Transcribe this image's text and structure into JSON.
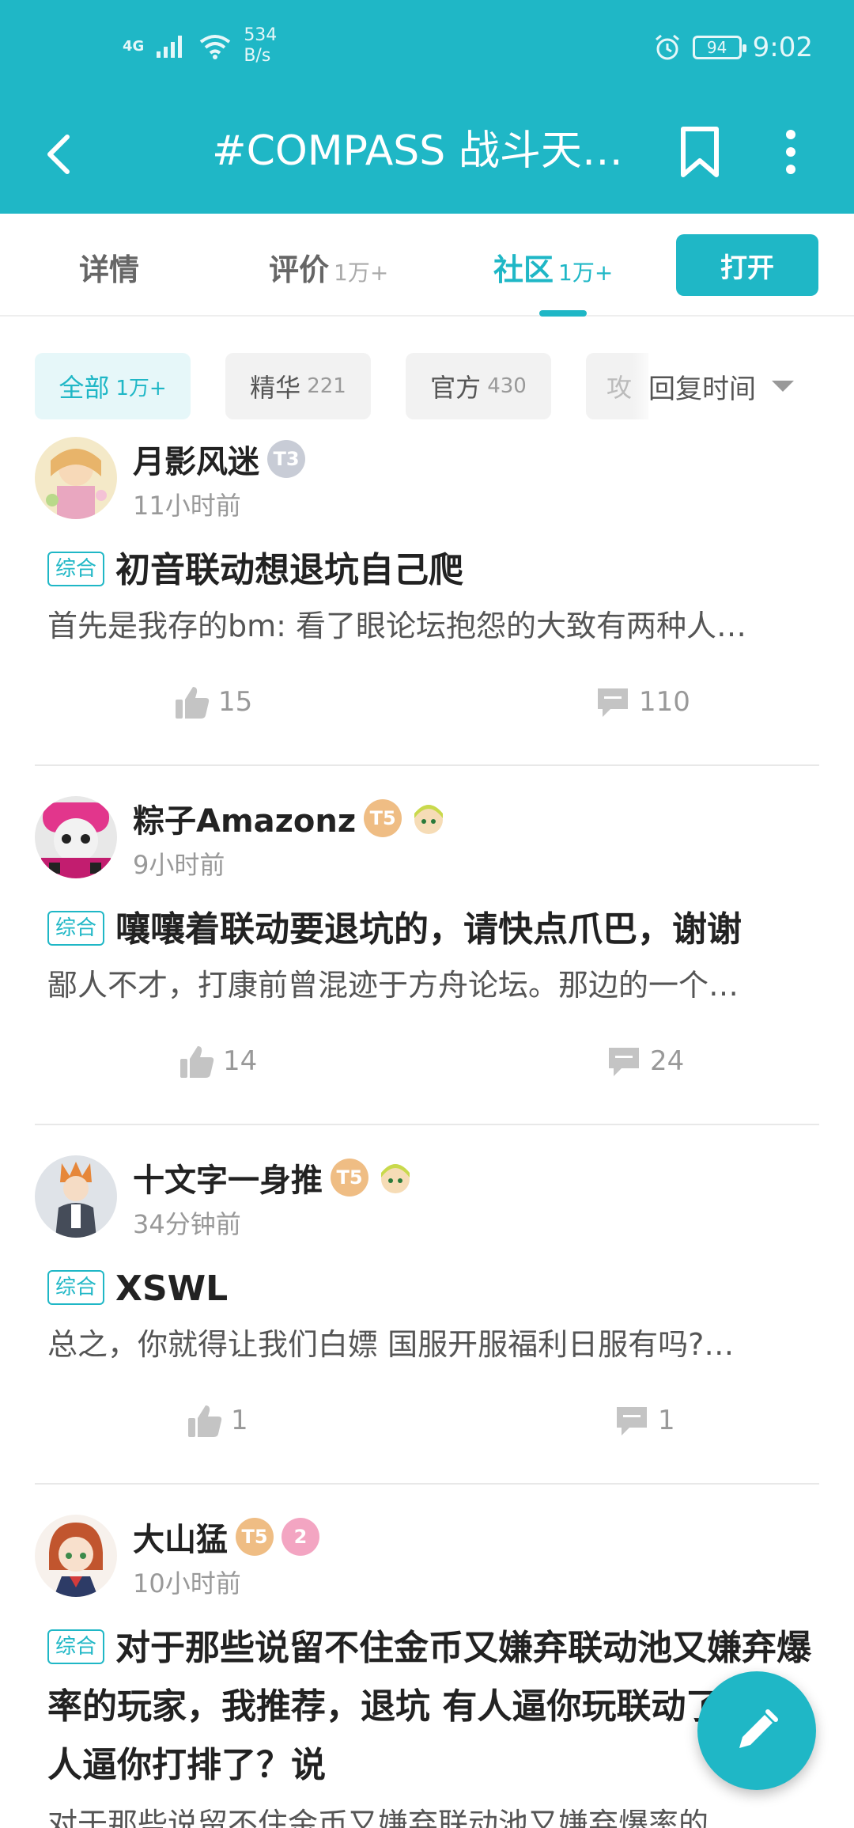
{
  "status_bar": {
    "network": "4G",
    "speed_value": "534",
    "speed_unit": "B/s",
    "battery": "94",
    "time": "9:02"
  },
  "header": {
    "title": "#COMPASS 战斗天赋…",
    "back_icon": "back-arrow-icon",
    "bookmark_icon": "bookmark-icon",
    "more_icon": "more-vertical-icon",
    "color": "#1fb7c6"
  },
  "tabs": {
    "items": [
      {
        "label": "详情",
        "count": ""
      },
      {
        "label": "评价",
        "count": "1万+"
      },
      {
        "label": "社区",
        "count": "1万+"
      }
    ],
    "active_index": 2,
    "open_button": "打开"
  },
  "filters": {
    "chips": [
      {
        "label": "全部",
        "count": "1万+"
      },
      {
        "label": "精华",
        "count": "221"
      },
      {
        "label": "官方",
        "count": "430"
      },
      {
        "label": "攻",
        "count": ""
      }
    ],
    "sort_label": "回复时间"
  },
  "posts": [
    {
      "author": "月影风迷",
      "time": "11小时前",
      "tag": "综合",
      "title": "初音联动想退坑自己爬",
      "excerpt": "首先是我存的bm: 看了眼论坛抱怨的大致有两种人…",
      "likes": "15",
      "comments": "110",
      "badges": [
        "T3"
      ]
    },
    {
      "author": "粽子Amazonz",
      "time": "9小时前",
      "tag": "综合",
      "title": "嚷嚷着联动要退坑的，请快点爪巴，谢谢",
      "excerpt": "鄙人不才，打康前曾混迹于方舟论坛。那边的一个…",
      "likes": "14",
      "comments": "24",
      "badges": [
        "T5",
        "face"
      ]
    },
    {
      "author": "十文字一身推",
      "time": "34分钟前",
      "tag": "综合",
      "title": "XSWL",
      "excerpt": "总之，你就得让我们白嫖 国服开服福利日服有吗?…",
      "likes": "1",
      "comments": "1",
      "badges": [
        "T5",
        "face"
      ]
    },
    {
      "author": "大山猛",
      "time": "10小时前",
      "tag": "综合",
      "title": "对于那些说留不住金币又嫌弃联动池又嫌弃爆率的玩家，我推荐，退坑 有人逼你玩联动了？有人逼你打排了？说",
      "excerpt": "对于那些说留不住金币又嫌弃联动池又嫌弃爆率的",
      "badges": [
        "T5",
        "2"
      ]
    }
  ],
  "fab_icon": "edit-pencil-icon"
}
